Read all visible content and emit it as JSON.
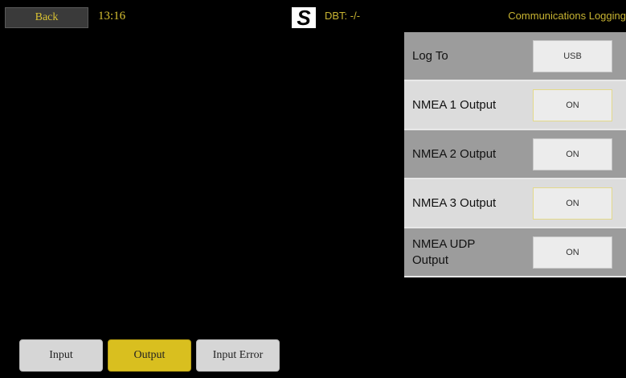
{
  "header": {
    "back_label": "Back",
    "time": "13:16",
    "logo_letter": "S",
    "dbt": "DBT: -/-",
    "title": "Communications Logging"
  },
  "settings": [
    {
      "label": "Log To",
      "value": "USB"
    },
    {
      "label": "NMEA 1 Output",
      "value": "ON"
    },
    {
      "label": "NMEA 2 Output",
      "value": "ON"
    },
    {
      "label": "NMEA 3 Output",
      "value": "ON"
    },
    {
      "label": "NMEA UDP Output",
      "value": "ON"
    }
  ],
  "tabs": [
    {
      "label": "Input",
      "active": false
    },
    {
      "label": "Output",
      "active": true
    },
    {
      "label": "Input Error",
      "active": false
    }
  ],
  "colors": {
    "accent_yellow": "#d9bf1f",
    "header_text": "#c8b432",
    "row_dark": "#9c9c9c",
    "row_light": "#dcdcdc"
  }
}
